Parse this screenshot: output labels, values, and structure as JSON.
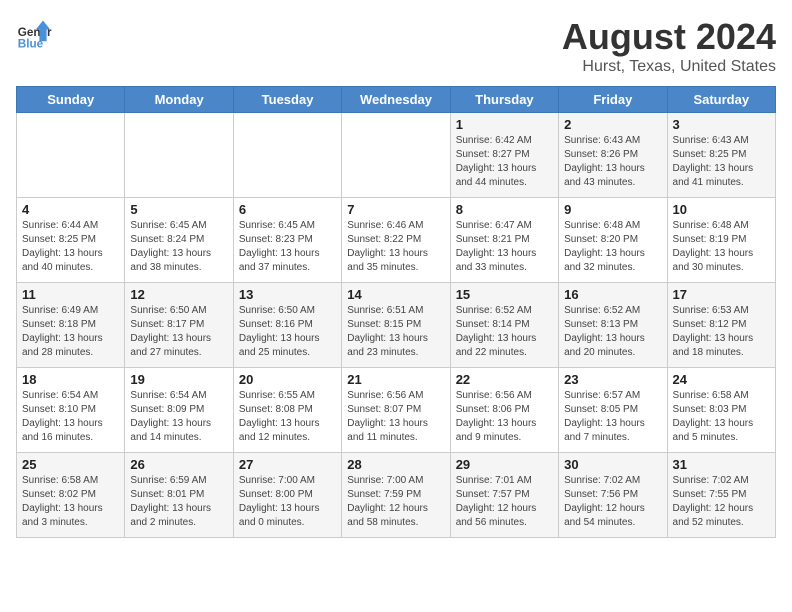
{
  "header": {
    "logo_line1": "General",
    "logo_line2": "Blue",
    "month_title": "August 2024",
    "location": "Hurst, Texas, United States"
  },
  "weekdays": [
    "Sunday",
    "Monday",
    "Tuesday",
    "Wednesday",
    "Thursday",
    "Friday",
    "Saturday"
  ],
  "weeks": [
    [
      {
        "day": "",
        "info": ""
      },
      {
        "day": "",
        "info": ""
      },
      {
        "day": "",
        "info": ""
      },
      {
        "day": "",
        "info": ""
      },
      {
        "day": "1",
        "info": "Sunrise: 6:42 AM\nSunset: 8:27 PM\nDaylight: 13 hours\nand 44 minutes."
      },
      {
        "day": "2",
        "info": "Sunrise: 6:43 AM\nSunset: 8:26 PM\nDaylight: 13 hours\nand 43 minutes."
      },
      {
        "day": "3",
        "info": "Sunrise: 6:43 AM\nSunset: 8:25 PM\nDaylight: 13 hours\nand 41 minutes."
      }
    ],
    [
      {
        "day": "4",
        "info": "Sunrise: 6:44 AM\nSunset: 8:25 PM\nDaylight: 13 hours\nand 40 minutes."
      },
      {
        "day": "5",
        "info": "Sunrise: 6:45 AM\nSunset: 8:24 PM\nDaylight: 13 hours\nand 38 minutes."
      },
      {
        "day": "6",
        "info": "Sunrise: 6:45 AM\nSunset: 8:23 PM\nDaylight: 13 hours\nand 37 minutes."
      },
      {
        "day": "7",
        "info": "Sunrise: 6:46 AM\nSunset: 8:22 PM\nDaylight: 13 hours\nand 35 minutes."
      },
      {
        "day": "8",
        "info": "Sunrise: 6:47 AM\nSunset: 8:21 PM\nDaylight: 13 hours\nand 33 minutes."
      },
      {
        "day": "9",
        "info": "Sunrise: 6:48 AM\nSunset: 8:20 PM\nDaylight: 13 hours\nand 32 minutes."
      },
      {
        "day": "10",
        "info": "Sunrise: 6:48 AM\nSunset: 8:19 PM\nDaylight: 13 hours\nand 30 minutes."
      }
    ],
    [
      {
        "day": "11",
        "info": "Sunrise: 6:49 AM\nSunset: 8:18 PM\nDaylight: 13 hours\nand 28 minutes."
      },
      {
        "day": "12",
        "info": "Sunrise: 6:50 AM\nSunset: 8:17 PM\nDaylight: 13 hours\nand 27 minutes."
      },
      {
        "day": "13",
        "info": "Sunrise: 6:50 AM\nSunset: 8:16 PM\nDaylight: 13 hours\nand 25 minutes."
      },
      {
        "day": "14",
        "info": "Sunrise: 6:51 AM\nSunset: 8:15 PM\nDaylight: 13 hours\nand 23 minutes."
      },
      {
        "day": "15",
        "info": "Sunrise: 6:52 AM\nSunset: 8:14 PM\nDaylight: 13 hours\nand 22 minutes."
      },
      {
        "day": "16",
        "info": "Sunrise: 6:52 AM\nSunset: 8:13 PM\nDaylight: 13 hours\nand 20 minutes."
      },
      {
        "day": "17",
        "info": "Sunrise: 6:53 AM\nSunset: 8:12 PM\nDaylight: 13 hours\nand 18 minutes."
      }
    ],
    [
      {
        "day": "18",
        "info": "Sunrise: 6:54 AM\nSunset: 8:10 PM\nDaylight: 13 hours\nand 16 minutes."
      },
      {
        "day": "19",
        "info": "Sunrise: 6:54 AM\nSunset: 8:09 PM\nDaylight: 13 hours\nand 14 minutes."
      },
      {
        "day": "20",
        "info": "Sunrise: 6:55 AM\nSunset: 8:08 PM\nDaylight: 13 hours\nand 12 minutes."
      },
      {
        "day": "21",
        "info": "Sunrise: 6:56 AM\nSunset: 8:07 PM\nDaylight: 13 hours\nand 11 minutes."
      },
      {
        "day": "22",
        "info": "Sunrise: 6:56 AM\nSunset: 8:06 PM\nDaylight: 13 hours\nand 9 minutes."
      },
      {
        "day": "23",
        "info": "Sunrise: 6:57 AM\nSunset: 8:05 PM\nDaylight: 13 hours\nand 7 minutes."
      },
      {
        "day": "24",
        "info": "Sunrise: 6:58 AM\nSunset: 8:03 PM\nDaylight: 13 hours\nand 5 minutes."
      }
    ],
    [
      {
        "day": "25",
        "info": "Sunrise: 6:58 AM\nSunset: 8:02 PM\nDaylight: 13 hours\nand 3 minutes."
      },
      {
        "day": "26",
        "info": "Sunrise: 6:59 AM\nSunset: 8:01 PM\nDaylight: 13 hours\nand 2 minutes."
      },
      {
        "day": "27",
        "info": "Sunrise: 7:00 AM\nSunset: 8:00 PM\nDaylight: 13 hours\nand 0 minutes."
      },
      {
        "day": "28",
        "info": "Sunrise: 7:00 AM\nSunset: 7:59 PM\nDaylight: 12 hours\nand 58 minutes."
      },
      {
        "day": "29",
        "info": "Sunrise: 7:01 AM\nSunset: 7:57 PM\nDaylight: 12 hours\nand 56 minutes."
      },
      {
        "day": "30",
        "info": "Sunrise: 7:02 AM\nSunset: 7:56 PM\nDaylight: 12 hours\nand 54 minutes."
      },
      {
        "day": "31",
        "info": "Sunrise: 7:02 AM\nSunset: 7:55 PM\nDaylight: 12 hours\nand 52 minutes."
      }
    ]
  ]
}
